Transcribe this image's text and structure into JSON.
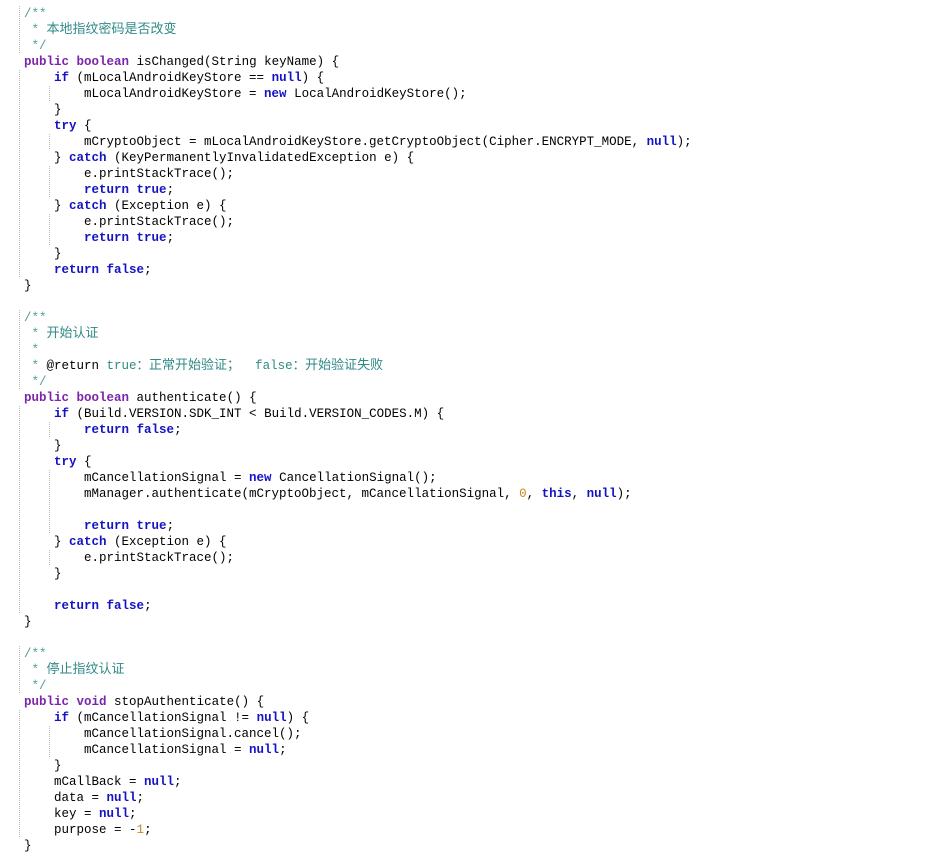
{
  "editor": {
    "language": "java",
    "background": "#ffffff",
    "colors": {
      "plain": "#000000",
      "modifier_keyword": "#7a26a8",
      "control_keyword": "#1313c4",
      "comment": "#2f8a86",
      "comment_tag": "#2f8a86",
      "number": "#c58a1a",
      "indent_guide": "#b9b9b9"
    },
    "blocks": [
      {
        "name": "isChanged",
        "doc_summary": "本地指纹密码是否改变",
        "signature": "public boolean isChanged(String keyName)"
      },
      {
        "name": "authenticate",
        "doc_summary": "开始认证",
        "doc_return": "@return true：正常开始验证；  false：开始验证失败",
        "signature": "public boolean authenticate()"
      },
      {
        "name": "stopAuthenticate",
        "doc_summary": "停止指纹认证",
        "signature": "public void stopAuthenticate()"
      }
    ],
    "lines": [
      {
        "i": 0,
        "indent": 0,
        "guides": [
          0
        ],
        "tokens": [
          {
            "t": "/**",
            "c": "cmtd"
          }
        ]
      },
      {
        "i": 1,
        "indent": 0,
        "guides": [
          0
        ],
        "tokens": [
          {
            "t": " * ",
            "c": "cmtd"
          },
          {
            "t": "本地指纹密码是否改变",
            "c": "cmt cjk"
          }
        ]
      },
      {
        "i": 2,
        "indent": 0,
        "guides": [
          0
        ],
        "tokens": [
          {
            "t": " */",
            "c": "cmtd"
          }
        ]
      },
      {
        "i": 3,
        "indent": 0,
        "guides": [],
        "tokens": [
          {
            "t": "public",
            "c": "kw"
          },
          {
            "t": " ",
            "c": "pln"
          },
          {
            "t": "boolean",
            "c": "kw"
          },
          {
            "t": " isChanged(String keyName) {",
            "c": "pln"
          }
        ]
      },
      {
        "i": 4,
        "indent": 1,
        "guides": [
          0
        ],
        "tokens": [
          {
            "t": "    ",
            "c": "pln"
          },
          {
            "t": "if",
            "c": "kw2"
          },
          {
            "t": " (mLocalAndroidKeyStore == ",
            "c": "pln"
          },
          {
            "t": "null",
            "c": "kw2"
          },
          {
            "t": ") {",
            "c": "pln"
          }
        ]
      },
      {
        "i": 5,
        "indent": 2,
        "guides": [
          0,
          1
        ],
        "tokens": [
          {
            "t": "        mLocalAndroidKeyStore = ",
            "c": "pln"
          },
          {
            "t": "new",
            "c": "kw2"
          },
          {
            "t": " LocalAndroidKeyStore();",
            "c": "pln"
          }
        ]
      },
      {
        "i": 6,
        "indent": 1,
        "guides": [
          0
        ],
        "tokens": [
          {
            "t": "    }",
            "c": "pln"
          }
        ]
      },
      {
        "i": 7,
        "indent": 1,
        "guides": [
          0
        ],
        "tokens": [
          {
            "t": "    ",
            "c": "pln"
          },
          {
            "t": "try",
            "c": "kw2"
          },
          {
            "t": " {",
            "c": "pln"
          }
        ]
      },
      {
        "i": 8,
        "indent": 2,
        "guides": [
          0,
          1
        ],
        "tokens": [
          {
            "t": "        mCryptoObject = mLocalAndroidKeyStore.getCryptoObject(Cipher.ENCRYPT_MODE, ",
            "c": "pln"
          },
          {
            "t": "null",
            "c": "kw2"
          },
          {
            "t": ");",
            "c": "pln"
          }
        ]
      },
      {
        "i": 9,
        "indent": 1,
        "guides": [
          0
        ],
        "tokens": [
          {
            "t": "    } ",
            "c": "pln"
          },
          {
            "t": "catch",
            "c": "kw2"
          },
          {
            "t": " (KeyPermanentlyInvalidatedException e) {",
            "c": "pln"
          }
        ]
      },
      {
        "i": 10,
        "indent": 2,
        "guides": [
          0,
          1
        ],
        "tokens": [
          {
            "t": "        e.printStackTrace();",
            "c": "pln"
          }
        ]
      },
      {
        "i": 11,
        "indent": 2,
        "guides": [
          0,
          1
        ],
        "tokens": [
          {
            "t": "        ",
            "c": "pln"
          },
          {
            "t": "return",
            "c": "kw2"
          },
          {
            "t": " ",
            "c": "pln"
          },
          {
            "t": "true",
            "c": "kw2"
          },
          {
            "t": ";",
            "c": "pln"
          }
        ]
      },
      {
        "i": 12,
        "indent": 1,
        "guides": [
          0
        ],
        "tokens": [
          {
            "t": "    } ",
            "c": "pln"
          },
          {
            "t": "catch",
            "c": "kw2"
          },
          {
            "t": " (Exception e) {",
            "c": "pln"
          }
        ]
      },
      {
        "i": 13,
        "indent": 2,
        "guides": [
          0,
          1
        ],
        "tokens": [
          {
            "t": "        e.printStackTrace();",
            "c": "pln"
          }
        ]
      },
      {
        "i": 14,
        "indent": 2,
        "guides": [
          0,
          1
        ],
        "tokens": [
          {
            "t": "        ",
            "c": "pln"
          },
          {
            "t": "return",
            "c": "kw2"
          },
          {
            "t": " ",
            "c": "pln"
          },
          {
            "t": "true",
            "c": "kw2"
          },
          {
            "t": ";",
            "c": "pln"
          }
        ]
      },
      {
        "i": 15,
        "indent": 1,
        "guides": [
          0
        ],
        "tokens": [
          {
            "t": "    }",
            "c": "pln"
          }
        ]
      },
      {
        "i": 16,
        "indent": 1,
        "guides": [
          0
        ],
        "tokens": [
          {
            "t": "    ",
            "c": "pln"
          },
          {
            "t": "return",
            "c": "kw2"
          },
          {
            "t": " ",
            "c": "pln"
          },
          {
            "t": "false",
            "c": "kw2"
          },
          {
            "t": ";",
            "c": "pln"
          }
        ]
      },
      {
        "i": 17,
        "indent": 0,
        "guides": [],
        "tokens": [
          {
            "t": "}",
            "c": "pln"
          }
        ]
      },
      {
        "i": 18,
        "indent": 0,
        "guides": [],
        "tokens": []
      },
      {
        "i": 19,
        "indent": 0,
        "guides": [
          0
        ],
        "tokens": [
          {
            "t": "/**",
            "c": "cmtd"
          }
        ]
      },
      {
        "i": 20,
        "indent": 0,
        "guides": [
          0
        ],
        "tokens": [
          {
            "t": " * ",
            "c": "cmtd"
          },
          {
            "t": "开始认证",
            "c": "cmt cjk"
          }
        ]
      },
      {
        "i": 21,
        "indent": 0,
        "guides": [
          0
        ],
        "tokens": [
          {
            "t": " *",
            "c": "cmtd"
          }
        ]
      },
      {
        "i": 22,
        "indent": 0,
        "guides": [
          0
        ],
        "tokens": [
          {
            "t": " * ",
            "c": "cmtd"
          },
          {
            "t": "@return",
            "c": "cmtb"
          },
          {
            "t": " true：",
            "c": "cmt"
          },
          {
            "t": "正常开始验证；",
            "c": "cmt cjk"
          },
          {
            "t": "  false：",
            "c": "cmt"
          },
          {
            "t": "开始验证失败",
            "c": "cmt cjk"
          }
        ]
      },
      {
        "i": 23,
        "indent": 0,
        "guides": [
          0
        ],
        "tokens": [
          {
            "t": " */",
            "c": "cmtd"
          }
        ]
      },
      {
        "i": 24,
        "indent": 0,
        "guides": [],
        "tokens": [
          {
            "t": "public",
            "c": "kw"
          },
          {
            "t": " ",
            "c": "pln"
          },
          {
            "t": "boolean",
            "c": "kw"
          },
          {
            "t": " authenticate() {",
            "c": "pln"
          }
        ]
      },
      {
        "i": 25,
        "indent": 1,
        "guides": [
          0
        ],
        "tokens": [
          {
            "t": "    ",
            "c": "pln"
          },
          {
            "t": "if",
            "c": "kw2"
          },
          {
            "t": " (Build.VERSION.SDK_INT < Build.VERSION_CODES.M) {",
            "c": "pln"
          }
        ]
      },
      {
        "i": 26,
        "indent": 2,
        "guides": [
          0,
          1
        ],
        "tokens": [
          {
            "t": "        ",
            "c": "pln"
          },
          {
            "t": "return",
            "c": "kw2"
          },
          {
            "t": " ",
            "c": "pln"
          },
          {
            "t": "false",
            "c": "kw2"
          },
          {
            "t": ";",
            "c": "pln"
          }
        ]
      },
      {
        "i": 27,
        "indent": 1,
        "guides": [
          0
        ],
        "tokens": [
          {
            "t": "    }",
            "c": "pln"
          }
        ]
      },
      {
        "i": 28,
        "indent": 1,
        "guides": [
          0
        ],
        "tokens": [
          {
            "t": "    ",
            "c": "pln"
          },
          {
            "t": "try",
            "c": "kw2"
          },
          {
            "t": " {",
            "c": "pln"
          }
        ]
      },
      {
        "i": 29,
        "indent": 2,
        "guides": [
          0,
          1
        ],
        "tokens": [
          {
            "t": "        mCancellationSignal = ",
            "c": "pln"
          },
          {
            "t": "new",
            "c": "kw2"
          },
          {
            "t": " CancellationSignal();",
            "c": "pln"
          }
        ]
      },
      {
        "i": 30,
        "indent": 2,
        "guides": [
          0,
          1
        ],
        "tokens": [
          {
            "t": "        mManager.authenticate(mCryptoObject, mCancellationSignal, ",
            "c": "pln"
          },
          {
            "t": "0",
            "c": "num"
          },
          {
            "t": ", ",
            "c": "pln"
          },
          {
            "t": "this",
            "c": "kw2"
          },
          {
            "t": ", ",
            "c": "pln"
          },
          {
            "t": "null",
            "c": "kw2"
          },
          {
            "t": ");",
            "c": "pln"
          }
        ]
      },
      {
        "i": 31,
        "indent": 2,
        "guides": [
          0,
          1
        ],
        "tokens": []
      },
      {
        "i": 32,
        "indent": 2,
        "guides": [
          0,
          1
        ],
        "tokens": [
          {
            "t": "        ",
            "c": "pln"
          },
          {
            "t": "return",
            "c": "kw2"
          },
          {
            "t": " ",
            "c": "pln"
          },
          {
            "t": "true",
            "c": "kw2"
          },
          {
            "t": ";",
            "c": "pln"
          }
        ]
      },
      {
        "i": 33,
        "indent": 1,
        "guides": [
          0
        ],
        "tokens": [
          {
            "t": "    } ",
            "c": "pln"
          },
          {
            "t": "catch",
            "c": "kw2"
          },
          {
            "t": " (Exception e) {",
            "c": "pln"
          }
        ]
      },
      {
        "i": 34,
        "indent": 2,
        "guides": [
          0,
          1
        ],
        "tokens": [
          {
            "t": "        e.printStackTrace();",
            "c": "pln"
          }
        ]
      },
      {
        "i": 35,
        "indent": 1,
        "guides": [
          0
        ],
        "tokens": [
          {
            "t": "    }",
            "c": "pln"
          }
        ]
      },
      {
        "i": 36,
        "indent": 1,
        "guides": [
          0
        ],
        "tokens": []
      },
      {
        "i": 37,
        "indent": 1,
        "guides": [
          0
        ],
        "tokens": [
          {
            "t": "    ",
            "c": "pln"
          },
          {
            "t": "return",
            "c": "kw2"
          },
          {
            "t": " ",
            "c": "pln"
          },
          {
            "t": "false",
            "c": "kw2"
          },
          {
            "t": ";",
            "c": "pln"
          }
        ]
      },
      {
        "i": 38,
        "indent": 0,
        "guides": [],
        "tokens": [
          {
            "t": "}",
            "c": "pln"
          }
        ]
      },
      {
        "i": 39,
        "indent": 0,
        "guides": [],
        "tokens": []
      },
      {
        "i": 40,
        "indent": 0,
        "guides": [
          0
        ],
        "tokens": [
          {
            "t": "/**",
            "c": "cmtd"
          }
        ]
      },
      {
        "i": 41,
        "indent": 0,
        "guides": [
          0
        ],
        "tokens": [
          {
            "t": " * ",
            "c": "cmtd"
          },
          {
            "t": "停止指纹认证",
            "c": "cmt cjk"
          }
        ]
      },
      {
        "i": 42,
        "indent": 0,
        "guides": [
          0
        ],
        "tokens": [
          {
            "t": " */",
            "c": "cmtd"
          }
        ]
      },
      {
        "i": 43,
        "indent": 0,
        "guides": [],
        "tokens": [
          {
            "t": "public",
            "c": "kw"
          },
          {
            "t": " ",
            "c": "pln"
          },
          {
            "t": "void",
            "c": "kw"
          },
          {
            "t": " stopAuthenticate() {",
            "c": "pln"
          }
        ]
      },
      {
        "i": 44,
        "indent": 1,
        "guides": [
          0
        ],
        "tokens": [
          {
            "t": "    ",
            "c": "pln"
          },
          {
            "t": "if",
            "c": "kw2"
          },
          {
            "t": " (mCancellationSignal != ",
            "c": "pln"
          },
          {
            "t": "null",
            "c": "kw2"
          },
          {
            "t": ") {",
            "c": "pln"
          }
        ]
      },
      {
        "i": 45,
        "indent": 2,
        "guides": [
          0,
          1
        ],
        "tokens": [
          {
            "t": "        mCancellationSignal.cancel();",
            "c": "pln"
          }
        ]
      },
      {
        "i": 46,
        "indent": 2,
        "guides": [
          0,
          1
        ],
        "tokens": [
          {
            "t": "        mCancellationSignal = ",
            "c": "pln"
          },
          {
            "t": "null",
            "c": "kw2"
          },
          {
            "t": ";",
            "c": "pln"
          }
        ]
      },
      {
        "i": 47,
        "indent": 1,
        "guides": [
          0
        ],
        "tokens": [
          {
            "t": "    }",
            "c": "pln"
          }
        ]
      },
      {
        "i": 48,
        "indent": 1,
        "guides": [
          0
        ],
        "tokens": [
          {
            "t": "    mCallBack = ",
            "c": "pln"
          },
          {
            "t": "null",
            "c": "kw2"
          },
          {
            "t": ";",
            "c": "pln"
          }
        ]
      },
      {
        "i": 49,
        "indent": 1,
        "guides": [
          0
        ],
        "tokens": [
          {
            "t": "    data = ",
            "c": "pln"
          },
          {
            "t": "null",
            "c": "kw2"
          },
          {
            "t": ";",
            "c": "pln"
          }
        ]
      },
      {
        "i": 50,
        "indent": 1,
        "guides": [
          0
        ],
        "tokens": [
          {
            "t": "    key = ",
            "c": "pln"
          },
          {
            "t": "null",
            "c": "kw2"
          },
          {
            "t": ";",
            "c": "pln"
          }
        ]
      },
      {
        "i": 51,
        "indent": 1,
        "guides": [
          0
        ],
        "tokens": [
          {
            "t": "    purpose = ",
            "c": "pln"
          },
          {
            "t": "-",
            "c": "pln"
          },
          {
            "t": "1",
            "c": "num"
          },
          {
            "t": ";",
            "c": "pln"
          }
        ]
      },
      {
        "i": 52,
        "indent": 0,
        "guides": [],
        "tokens": [
          {
            "t": "}",
            "c": "pln"
          }
        ]
      }
    ]
  }
}
